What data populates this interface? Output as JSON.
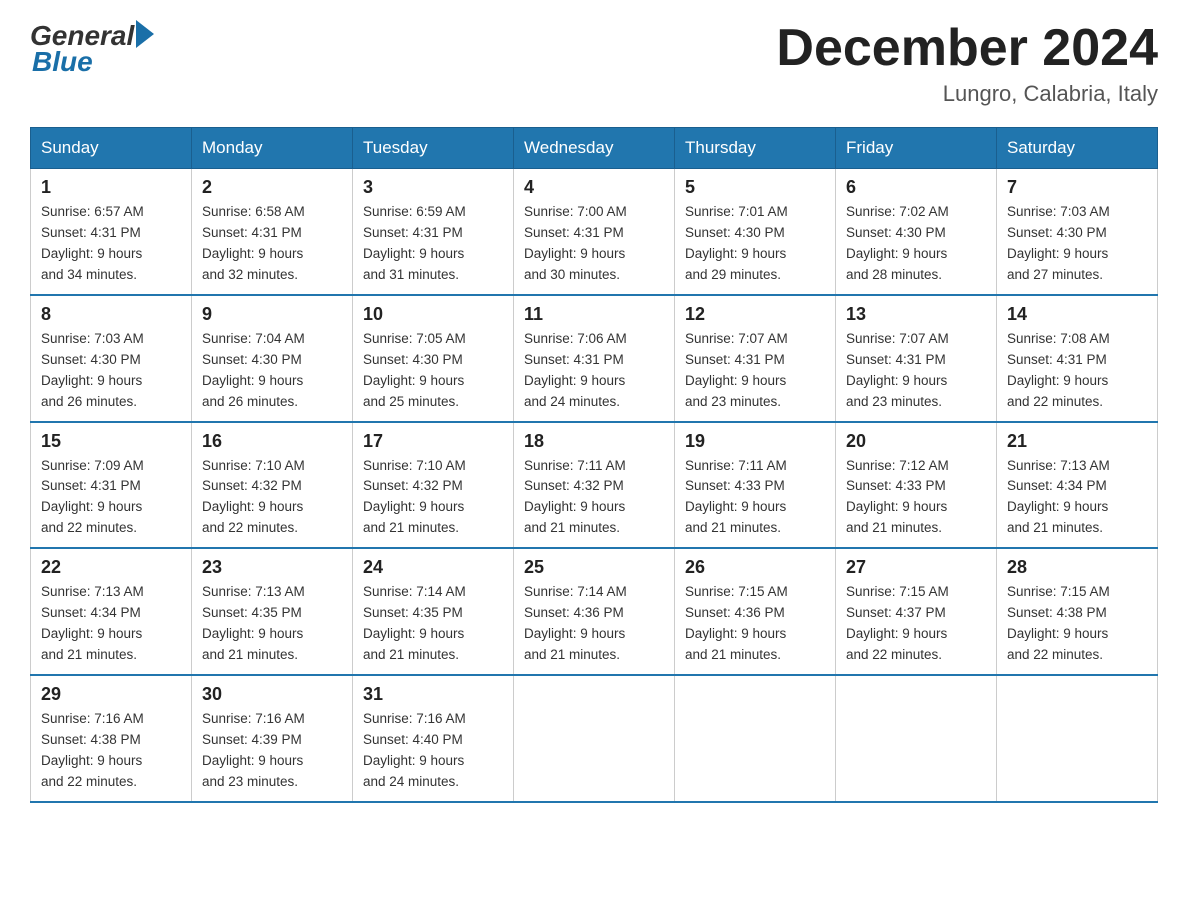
{
  "header": {
    "logo_general": "General",
    "logo_blue": "Blue",
    "month_title": "December 2024",
    "location": "Lungro, Calabria, Italy"
  },
  "days_of_week": [
    "Sunday",
    "Monday",
    "Tuesday",
    "Wednesday",
    "Thursday",
    "Friday",
    "Saturday"
  ],
  "weeks": [
    [
      {
        "day": "1",
        "sunrise": "6:57 AM",
        "sunset": "4:31 PM",
        "daylight": "9 hours and 34 minutes."
      },
      {
        "day": "2",
        "sunrise": "6:58 AM",
        "sunset": "4:31 PM",
        "daylight": "9 hours and 32 minutes."
      },
      {
        "day": "3",
        "sunrise": "6:59 AM",
        "sunset": "4:31 PM",
        "daylight": "9 hours and 31 minutes."
      },
      {
        "day": "4",
        "sunrise": "7:00 AM",
        "sunset": "4:31 PM",
        "daylight": "9 hours and 30 minutes."
      },
      {
        "day": "5",
        "sunrise": "7:01 AM",
        "sunset": "4:30 PM",
        "daylight": "9 hours and 29 minutes."
      },
      {
        "day": "6",
        "sunrise": "7:02 AM",
        "sunset": "4:30 PM",
        "daylight": "9 hours and 28 minutes."
      },
      {
        "day": "7",
        "sunrise": "7:03 AM",
        "sunset": "4:30 PM",
        "daylight": "9 hours and 27 minutes."
      }
    ],
    [
      {
        "day": "8",
        "sunrise": "7:03 AM",
        "sunset": "4:30 PM",
        "daylight": "9 hours and 26 minutes."
      },
      {
        "day": "9",
        "sunrise": "7:04 AM",
        "sunset": "4:30 PM",
        "daylight": "9 hours and 26 minutes."
      },
      {
        "day": "10",
        "sunrise": "7:05 AM",
        "sunset": "4:30 PM",
        "daylight": "9 hours and 25 minutes."
      },
      {
        "day": "11",
        "sunrise": "7:06 AM",
        "sunset": "4:31 PM",
        "daylight": "9 hours and 24 minutes."
      },
      {
        "day": "12",
        "sunrise": "7:07 AM",
        "sunset": "4:31 PM",
        "daylight": "9 hours and 23 minutes."
      },
      {
        "day": "13",
        "sunrise": "7:07 AM",
        "sunset": "4:31 PM",
        "daylight": "9 hours and 23 minutes."
      },
      {
        "day": "14",
        "sunrise": "7:08 AM",
        "sunset": "4:31 PM",
        "daylight": "9 hours and 22 minutes."
      }
    ],
    [
      {
        "day": "15",
        "sunrise": "7:09 AM",
        "sunset": "4:31 PM",
        "daylight": "9 hours and 22 minutes."
      },
      {
        "day": "16",
        "sunrise": "7:10 AM",
        "sunset": "4:32 PM",
        "daylight": "9 hours and 22 minutes."
      },
      {
        "day": "17",
        "sunrise": "7:10 AM",
        "sunset": "4:32 PM",
        "daylight": "9 hours and 21 minutes."
      },
      {
        "day": "18",
        "sunrise": "7:11 AM",
        "sunset": "4:32 PM",
        "daylight": "9 hours and 21 minutes."
      },
      {
        "day": "19",
        "sunrise": "7:11 AM",
        "sunset": "4:33 PM",
        "daylight": "9 hours and 21 minutes."
      },
      {
        "day": "20",
        "sunrise": "7:12 AM",
        "sunset": "4:33 PM",
        "daylight": "9 hours and 21 minutes."
      },
      {
        "day": "21",
        "sunrise": "7:13 AM",
        "sunset": "4:34 PM",
        "daylight": "9 hours and 21 minutes."
      }
    ],
    [
      {
        "day": "22",
        "sunrise": "7:13 AM",
        "sunset": "4:34 PM",
        "daylight": "9 hours and 21 minutes."
      },
      {
        "day": "23",
        "sunrise": "7:13 AM",
        "sunset": "4:35 PM",
        "daylight": "9 hours and 21 minutes."
      },
      {
        "day": "24",
        "sunrise": "7:14 AM",
        "sunset": "4:35 PM",
        "daylight": "9 hours and 21 minutes."
      },
      {
        "day": "25",
        "sunrise": "7:14 AM",
        "sunset": "4:36 PM",
        "daylight": "9 hours and 21 minutes."
      },
      {
        "day": "26",
        "sunrise": "7:15 AM",
        "sunset": "4:36 PM",
        "daylight": "9 hours and 21 minutes."
      },
      {
        "day": "27",
        "sunrise": "7:15 AM",
        "sunset": "4:37 PM",
        "daylight": "9 hours and 22 minutes."
      },
      {
        "day": "28",
        "sunrise": "7:15 AM",
        "sunset": "4:38 PM",
        "daylight": "9 hours and 22 minutes."
      }
    ],
    [
      {
        "day": "29",
        "sunrise": "7:16 AM",
        "sunset": "4:38 PM",
        "daylight": "9 hours and 22 minutes."
      },
      {
        "day": "30",
        "sunrise": "7:16 AM",
        "sunset": "4:39 PM",
        "daylight": "9 hours and 23 minutes."
      },
      {
        "day": "31",
        "sunrise": "7:16 AM",
        "sunset": "4:40 PM",
        "daylight": "9 hours and 24 minutes."
      },
      null,
      null,
      null,
      null
    ]
  ],
  "labels": {
    "sunrise": "Sunrise: ",
    "sunset": "Sunset: ",
    "daylight": "Daylight: "
  }
}
